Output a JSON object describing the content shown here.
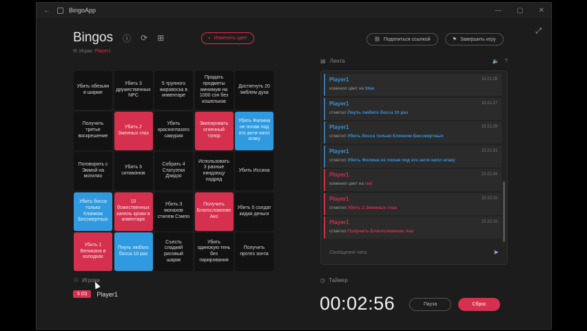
{
  "window": {
    "title": "BingoApp",
    "controls": [
      "—",
      "▢",
      "✕"
    ]
  },
  "header": {
    "title": "Bingos",
    "change_color_label": "Изменить цвет",
    "subtitle_prefix": "Я: Играк:",
    "subtitle_player": "Player1",
    "share_label": "Поделиться ссылкой",
    "finish_label": "Завершить игру"
  },
  "board": {
    "cells": [
      {
        "text": "Убить обезьян в ширме",
        "state": "none"
      },
      {
        "text": "Убить 3 дружественных NPC",
        "state": "none"
      },
      {
        "text": "5 трупного жировоска в инвентаре",
        "state": "none"
      },
      {
        "text": "Продать предметы минимум на 1000 сэн без кошельков",
        "state": "none"
      },
      {
        "text": "Достигнуть 20 эмблем духа",
        "state": "none"
      },
      {
        "text": "Получить третье воскрешение",
        "state": "none"
      },
      {
        "text": "Убить 2 Змеиных глаз",
        "state": "red"
      },
      {
        "text": "Убить красноглазого самурая",
        "state": "none"
      },
      {
        "text": "Экипировать огненный топор",
        "state": "red"
      },
      {
        "text": "Убить Филина не попав под его анти-хилл атаку",
        "state": "blue"
      },
      {
        "text": "Поговорить с Эммой на могилах",
        "state": "none"
      },
      {
        "text": "Убить 3 ситимэнов",
        "state": "none"
      },
      {
        "text": "Собрать 4 Статуэтки Дэидзо",
        "state": "none"
      },
      {
        "text": "Использовать 3 разные ниндзюцу подряд",
        "state": "none"
      },
      {
        "text": "Убить Иссина",
        "state": "none"
      },
      {
        "text": "Убить босса только Клинком Бессмертных",
        "state": "blue"
      },
      {
        "text": "10 божественных капель крови в инвентаре",
        "state": "red"
      },
      {
        "text": "Убить 3 монахов стилем Сэмпо",
        "state": "none"
      },
      {
        "text": "Получить Благословение Ако",
        "state": "red"
      },
      {
        "text": "Убить 5 солдат кидая деньги",
        "state": "none"
      },
      {
        "text": "Убить 1 Великана в колодках",
        "state": "red"
      },
      {
        "text": "Пнуть любого босса 10 раз",
        "state": "blue"
      },
      {
        "text": "Съесть сладкий рисовый шарик",
        "state": "none"
      },
      {
        "text": "Убить одинокую тень без парирования",
        "state": "none"
      },
      {
        "text": "Получить протез зонта",
        "state": "none"
      }
    ]
  },
  "players": {
    "label": "Игроки",
    "list": [
      {
        "score": "5 (0)",
        "name": "Player1"
      }
    ]
  },
  "feed": {
    "label": "Лента",
    "messages": [
      {
        "who": "Player1",
        "time": "15:21:26",
        "action": "изменил цвет на",
        "target": "blue",
        "color": "blue"
      },
      {
        "who": "Player1",
        "time": "15:21:27",
        "action": "отметил",
        "target": "Пнуть любого босса 10 раз",
        "color": "blue"
      },
      {
        "who": "Player1",
        "time": "15:21:29",
        "action": "отметил",
        "target": "Убить босса только Клинком Бессмертных",
        "color": "blue"
      },
      {
        "who": "Player1",
        "time": "15:21:31",
        "action": "отметил",
        "target": "Убить Филина не попав под его анти-хилл атаку",
        "color": "blue"
      },
      {
        "who": "Player1",
        "time": "15:21:34",
        "action": "изменил цвет на",
        "target": "red",
        "color": "red"
      },
      {
        "who": "Player1",
        "time": "15:22:15",
        "action": "отметил",
        "target": "Убить 2 Змеиных глаз",
        "color": "red"
      },
      {
        "who": "Player1",
        "time": "15:22:16",
        "action": "отметил",
        "target": "Получить Благословение Ако",
        "color": "red"
      }
    ],
    "chat_placeholder": "Сообщение чата"
  },
  "timer": {
    "label": "Таймер",
    "value": "00:02:56",
    "pause_label": "Пауза",
    "reset_label": "Сброс"
  }
}
